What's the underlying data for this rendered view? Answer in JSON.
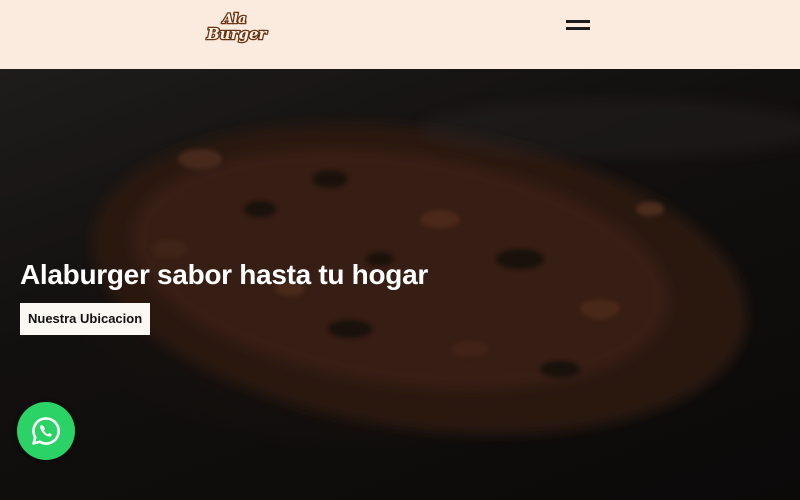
{
  "header": {
    "logo_text_top": "Ala",
    "logo_text_bottom": "Burger",
    "menu_icon": "hamburger-menu-icon",
    "background_color": "#fbebde"
  },
  "hero": {
    "title": "Alaburger sabor hasta tu hogar",
    "button_label": "Nuestra Ubicacion"
  },
  "floating": {
    "whatsapp_icon": "whatsapp-icon",
    "whatsapp_color": "#2bd366"
  }
}
